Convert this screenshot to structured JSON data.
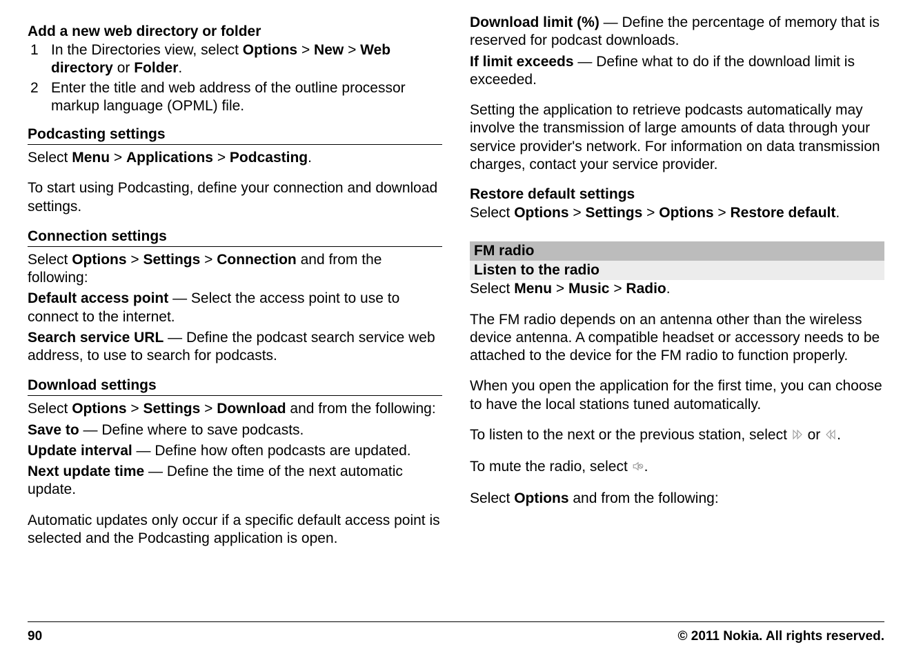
{
  "left": {
    "addDirHeading": "Add a new web directory or folder",
    "step1_a": "In the Directories view, select ",
    "step1_b": "Options",
    "step1_c": "New",
    "step1_d": "Web directory",
    "step1_or": " or ",
    "step1_e": "Folder",
    "step1_period": ".",
    "step2": "Enter the title and web address of the outline processor markup language (OPML) file.",
    "podSettingsHeading": "Podcasting settings",
    "podSettings_a": "Select ",
    "podSettings_b": "Menu",
    "podSettings_c": "Applications",
    "podSettings_d": "Podcasting",
    "podSettings_e": ".",
    "podStart": "To start using Podcasting, define your connection and download settings.",
    "connHeading": "Connection settings",
    "conn_a": "Select ",
    "conn_b": "Options",
    "conn_c": "Settings",
    "conn_d": "Connection",
    "conn_e": " and from the following:",
    "dap_label": "Default access point",
    "dap_text": "  — Select the access point to use to connect to the internet.",
    "ssu_label": "Search service URL",
    "ssu_text": "  — Define the podcast search service web address, to use to search for podcasts.",
    "dlHeading": "Download settings",
    "dl_a": "Select ",
    "dl_b": "Options",
    "dl_c": "Settings",
    "dl_d": "Download",
    "dl_e": " and from the following:",
    "saveTo_label": "Save to",
    "saveTo_text": "  — Define where to save podcasts.",
    "updInt_label": "Update interval",
    "updInt_text": "  — Define how often podcasts are updated.",
    "nextUpd_label": "Next update time",
    "nextUpd_text": "  — Define the time of the next automatic update.",
    "autoNote": "Automatic updates only occur if a specific default access point is selected and the Podcasting application is open."
  },
  "right": {
    "dlLimit_label": "Download limit (%)",
    "dlLimit_text": "  — Define the percentage of memory that is reserved for podcast downloads.",
    "ifLimit_label": "If limit exceeds",
    "ifLimit_text": "  — Define what to do if the download limit is exceeded.",
    "warn": "Setting the application to retrieve podcasts automatically may involve the transmission of large amounts of data through your service provider's network. For information on data transmission charges, contact your service provider.",
    "restoreHeading": "Restore default settings",
    "restore_a": "Select ",
    "restore_b": "Options",
    "restore_c": "Settings",
    "restore_d": "Options",
    "restore_e": "Restore default",
    "restore_f": ".",
    "fmRadio": "FM radio",
    "listenRadio": "Listen to the radio",
    "radio_a": "Select ",
    "radio_b": "Menu",
    "radio_c": "Music",
    "radio_d": "Radio",
    "radio_e": ".",
    "radioAntenna": "The FM radio depends on an antenna other than the wireless device antenna. A compatible headset or accessory needs to be attached to the device for the FM radio to function properly.",
    "radioFirst": "When you open the application for the first time, you can choose to have the local stations tuned automatically.",
    "radioListen_a": "To listen to the next or the previous station, select ",
    "radioListen_b": " or ",
    "radioListen_c": ".",
    "radioMute_a": "To mute the radio, select ",
    "radioMute_b": ".",
    "radioOptions_a": "Select ",
    "radioOptions_b": "Options",
    "radioOptions_c": " and from the following:"
  },
  "sep": " > ",
  "footer": {
    "page": "90",
    "copyright": "© 2011 Nokia. All rights reserved."
  }
}
